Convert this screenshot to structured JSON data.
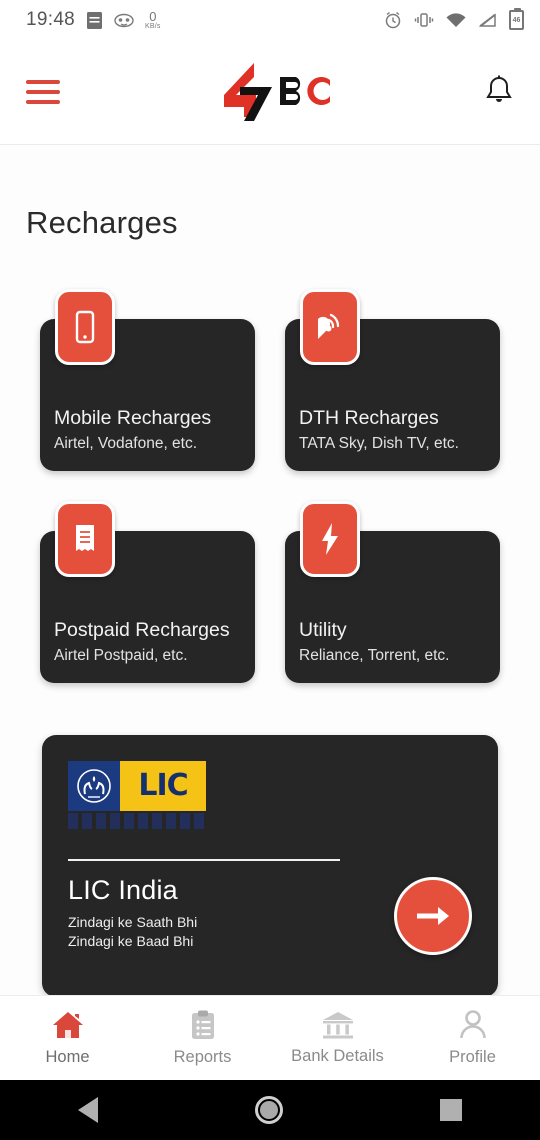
{
  "status_bar": {
    "time": "19:48",
    "network_speed_value": "0",
    "network_speed_unit": "KB/s",
    "battery_level": "46",
    "icons": [
      "notification-list-icon",
      "face-icon",
      "alarm-icon",
      "vibrate-icon",
      "wifi-icon",
      "signal-icon",
      "battery-icon"
    ]
  },
  "header": {
    "menu_icon": "hamburger-menu-icon",
    "logo_text": "47BC",
    "logo_mark": "47-lightning-logo",
    "notification_icon": "bell-icon"
  },
  "main": {
    "page_title": "Recharges",
    "tiles": [
      {
        "icon": "mobile-phone-icon",
        "title": "Mobile Recharges",
        "subtitle": "Airtel, Vodafone, etc."
      },
      {
        "icon": "satellite-dish-icon",
        "title": "DTH Recharges",
        "subtitle": "TATA Sky, Dish TV, etc."
      },
      {
        "icon": "receipt-icon",
        "title": "Postpaid Recharges",
        "subtitle": "Airtel Postpaid, etc."
      },
      {
        "icon": "lightning-bolt-icon",
        "title": "Utility",
        "subtitle": "Reliance, Torrent, etc."
      }
    ],
    "promo": {
      "logo_word": "LIC",
      "logo_emblem": "lic-hands-lamp-emblem",
      "name": "LIC India",
      "tagline_line1": "Zindagi ke Saath Bhi",
      "tagline_line2": "Zindagi ke Baad Bhi",
      "action_icon": "arrow-right-icon"
    }
  },
  "bottom_nav": {
    "items": [
      {
        "label": "Home",
        "icon": "home-icon",
        "active": true
      },
      {
        "label": "Reports",
        "icon": "clipboard-icon",
        "active": false
      },
      {
        "label": "Bank Details",
        "icon": "bank-icon",
        "active": false
      },
      {
        "label": "Profile",
        "icon": "person-icon",
        "active": false
      }
    ]
  },
  "android_nav": {
    "back": "back-triangle-icon",
    "home": "home-circle-icon",
    "recents": "recents-square-icon"
  },
  "colors": {
    "accent_red": "#e4503c",
    "card_dark": "#262626",
    "background": "#fdfdfd",
    "lic_blue": "#1b3a80",
    "lic_yellow": "#f5c316"
  }
}
